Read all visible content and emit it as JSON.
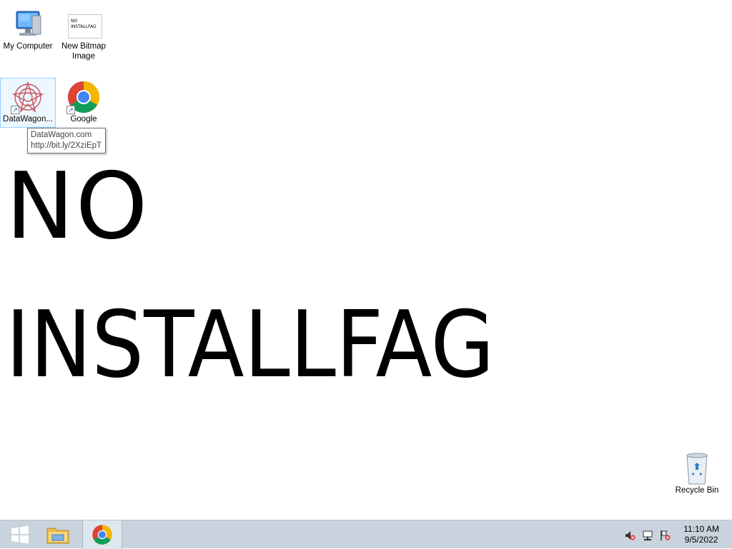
{
  "wallpaper": {
    "line1": "NO",
    "line2": "INSTALLFAG"
  },
  "desktop_icons": [
    {
      "label": "My Computer",
      "icon": "computer-icon"
    },
    {
      "label": "New Bitmap Image",
      "icon": "bitmap-icon",
      "thumbnail_text": "NO INSTALLFAG"
    },
    {
      "label": "DataWagon...",
      "icon": "datawagon-icon",
      "shortcut": true,
      "selected": true
    },
    {
      "label": "Google",
      "icon": "chrome-icon",
      "shortcut": true
    },
    {
      "label": "Recycle Bin",
      "icon": "recycle-bin-icon"
    }
  ],
  "tooltip": {
    "title": "DataWagon.com",
    "url": "http://bit.ly/2XziEpT"
  },
  "taskbar": {
    "buttons": [
      {
        "name": "start",
        "icon": "windows-logo-icon"
      },
      {
        "name": "file-explorer",
        "icon": "folder-icon"
      },
      {
        "name": "chrome",
        "icon": "chrome-icon",
        "active": true
      }
    ],
    "tray": [
      "speaker-muted-icon",
      "network-icon",
      "action-center-flag-icon"
    ],
    "clock": {
      "time": "11:10 AM",
      "date": "9/5/2022"
    }
  },
  "colors": {
    "taskbar_bg": "#c9d3dd",
    "selection_border": "#99d1ff",
    "chrome_red": "#db4437",
    "chrome_yellow": "#f4b400",
    "chrome_green": "#0f9d58",
    "chrome_blue": "#4285f4"
  }
}
